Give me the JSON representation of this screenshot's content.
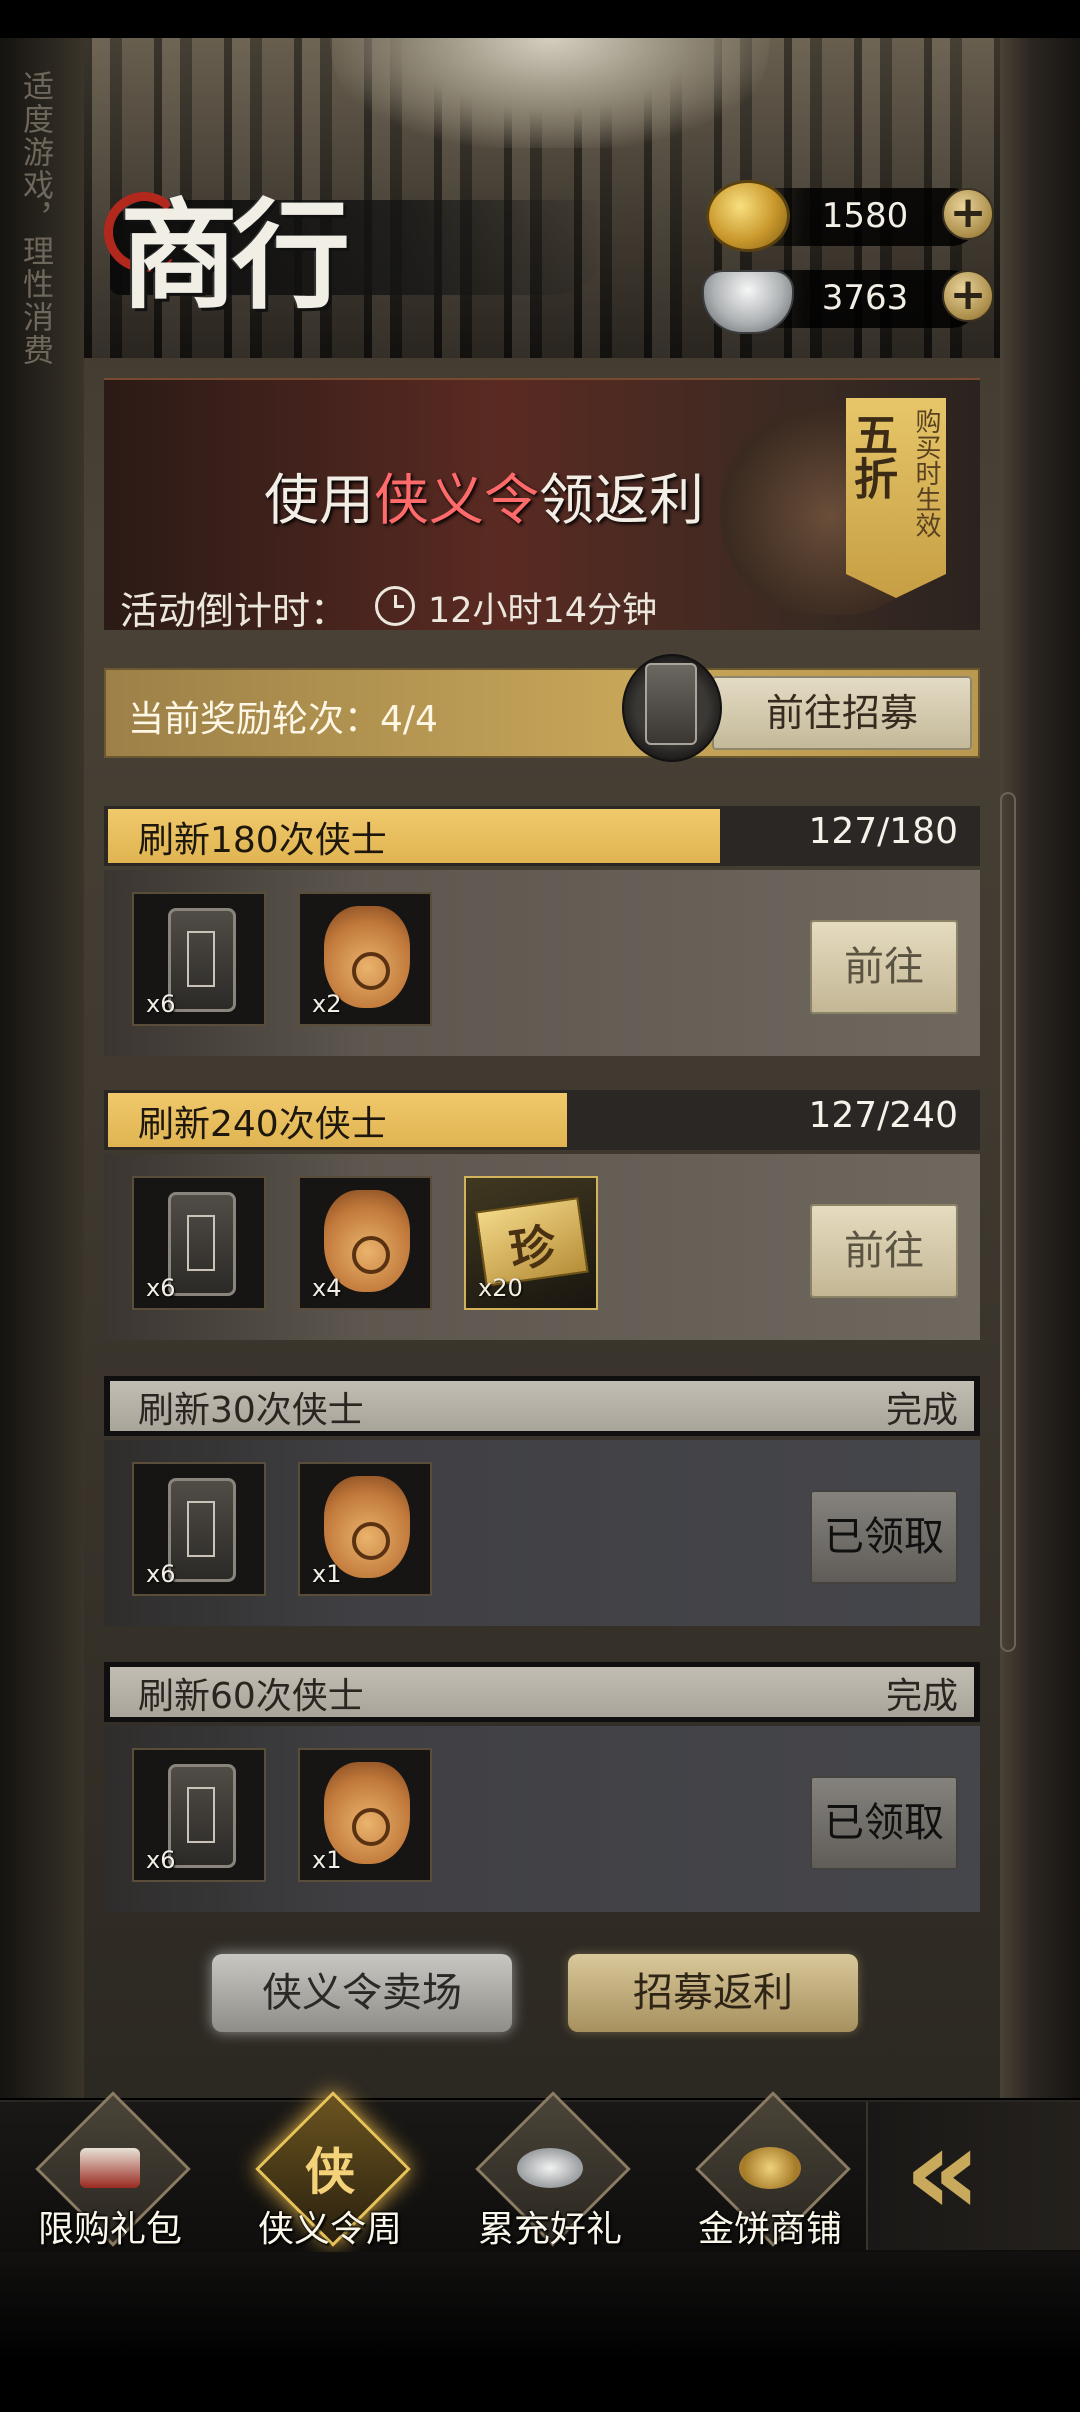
{
  "side_notice": "适度游戏，理性消费",
  "header": {
    "title": "商行",
    "gold": "1580",
    "silver": "3763"
  },
  "banner": {
    "headline_prefix": "使用",
    "headline_highlight": "侠义令",
    "headline_suffix": "领返利",
    "discount": "五折",
    "discount_note": "购买时生效",
    "countdown_label": "活动倒计时：",
    "countdown_value": "12小时14分钟"
  },
  "round": {
    "label": "当前奖励轮次：4/4",
    "button": "前往招募"
  },
  "tasks": [
    {
      "name": "刷新180次侠士",
      "progress": "127/180",
      "fraction": 0.7056,
      "state": "active",
      "button": "前往",
      "rewards": [
        {
          "icon": "token-icon",
          "count": "x6"
        },
        {
          "icon": "coin-bag-icon",
          "count": "x2"
        }
      ]
    },
    {
      "name": "刷新240次侠士",
      "progress": "127/240",
      "fraction": 0.5292,
      "state": "active",
      "button": "前往",
      "rewards": [
        {
          "icon": "token-icon",
          "count": "x6"
        },
        {
          "icon": "coin-bag-icon",
          "count": "x4"
        },
        {
          "icon": "treasure-icon",
          "count": "x20",
          "glyph": "珍"
        }
      ]
    },
    {
      "name": "刷新30次侠士",
      "progress": "完成",
      "state": "done",
      "button": "已领取",
      "rewards": [
        {
          "icon": "token-icon",
          "count": "x6"
        },
        {
          "icon": "coin-bag-icon",
          "count": "x1"
        }
      ]
    },
    {
      "name": "刷新60次侠士",
      "progress": "完成",
      "state": "done",
      "button": "已领取",
      "rewards": [
        {
          "icon": "token-icon",
          "count": "x6"
        },
        {
          "icon": "coin-bag-icon",
          "count": "x1"
        }
      ]
    }
  ],
  "bottom_buttons": {
    "market": "侠义令卖场",
    "rebate": "招募返利"
  },
  "nav": [
    {
      "label": "限购礼包",
      "icon": "gift-box-icon",
      "active": false
    },
    {
      "label": "侠义令周",
      "icon": "xia-token-icon",
      "glyph": "侠",
      "active": true
    },
    {
      "label": "累充好礼",
      "icon": "silver-pile-icon",
      "active": false
    },
    {
      "label": "金饼商铺",
      "icon": "gold-cakes-icon",
      "active": false
    }
  ],
  "colors": {
    "highlight": "#ff6a6a",
    "progress_fill": "#e8bd5a",
    "gold_accent": "#c7a659"
  }
}
